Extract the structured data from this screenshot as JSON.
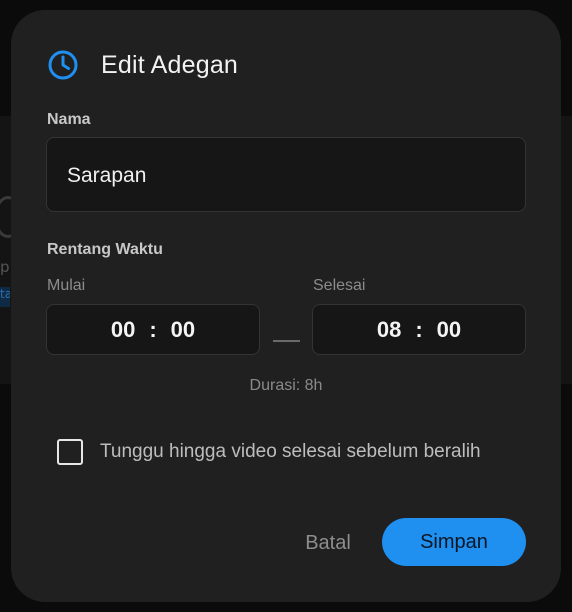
{
  "dialog": {
    "title": "Edit Adegan",
    "icon": "clock-icon",
    "accent_color": "#1f8ff0"
  },
  "name_field": {
    "label": "Nama",
    "value": "Sarapan"
  },
  "time_range": {
    "label": "Rentang Waktu",
    "start": {
      "label": "Mulai",
      "hours": "00",
      "minutes": "00"
    },
    "end": {
      "label": "Selesai",
      "hours": "08",
      "minutes": "00"
    },
    "separator": ":",
    "duration": "Durasi: 8h"
  },
  "wait_option": {
    "label": "Tunggu hingga video selesai sebelum beralih",
    "checked": false
  },
  "actions": {
    "cancel_label": "Batal",
    "save_label": "Simpan"
  }
}
